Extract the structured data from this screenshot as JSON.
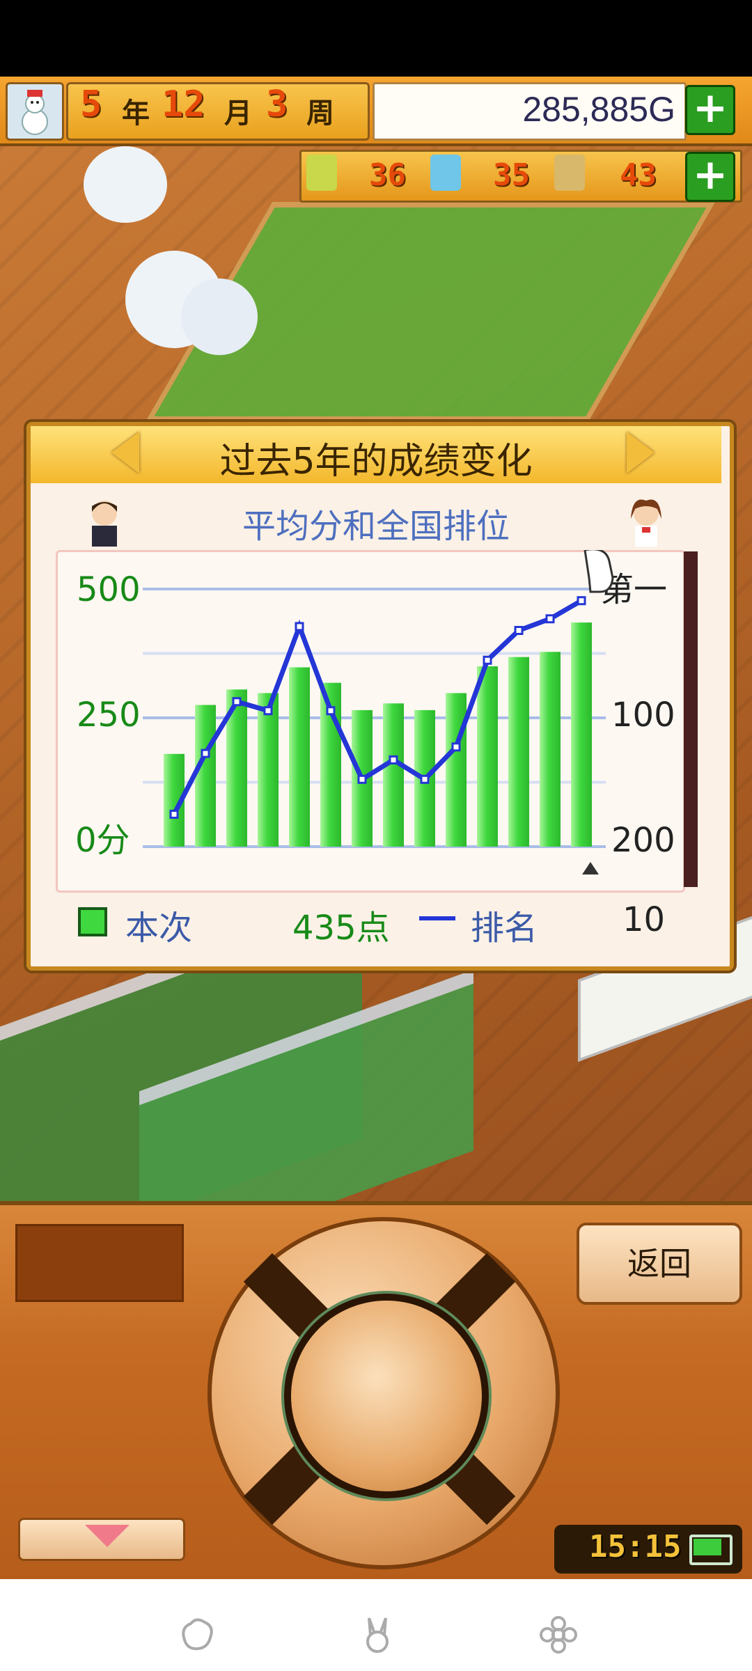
{
  "hud": {
    "year": "5",
    "year_unit": "年",
    "month": "12",
    "month_unit": "月",
    "week": "3",
    "week_unit": "周",
    "money": "285,885G",
    "season_icon": "snowman-icon"
  },
  "stats": {
    "stat1": "36",
    "stat2": "35",
    "stat3": "43",
    "stat1_icon": "pencil-icon",
    "stat2_icon": "flask-icon",
    "stat3_icon": "trophy-icon"
  },
  "dialog": {
    "title": "过去5年的成绩变化",
    "chart_title": "平均分和全国排位"
  },
  "legend": {
    "score_label": "本次",
    "score_value": "435点",
    "rank_label": "排名",
    "rank_value": "10"
  },
  "controls": {
    "back_label": "返回",
    "clock": "15:15"
  },
  "colors": {
    "bar_green": "#3fd83f",
    "line_blue": "#2436d6",
    "accent_orange": "#e64a0a"
  },
  "chart_data": {
    "type": "bar+line",
    "left_axis": {
      "ticks": [
        "500",
        "250",
        "0分"
      ],
      "ylim": [
        0,
        500
      ]
    },
    "right_axis": {
      "ticks": [
        "第一",
        "100",
        "200"
      ],
      "ylim": [
        1,
        200
      ],
      "inverted": true
    },
    "series": [
      {
        "kind": "bar",
        "values": [
          180,
          275,
          305,
          298,
          348,
          318,
          265,
          278,
          265,
          298,
          350,
          368,
          378,
          435
        ]
      },
      {
        "kind": "line",
        "values": [
          175,
          128,
          88,
          95,
          30,
          95,
          148,
          133,
          148,
          123,
          56,
          33,
          24,
          10
        ]
      }
    ]
  }
}
